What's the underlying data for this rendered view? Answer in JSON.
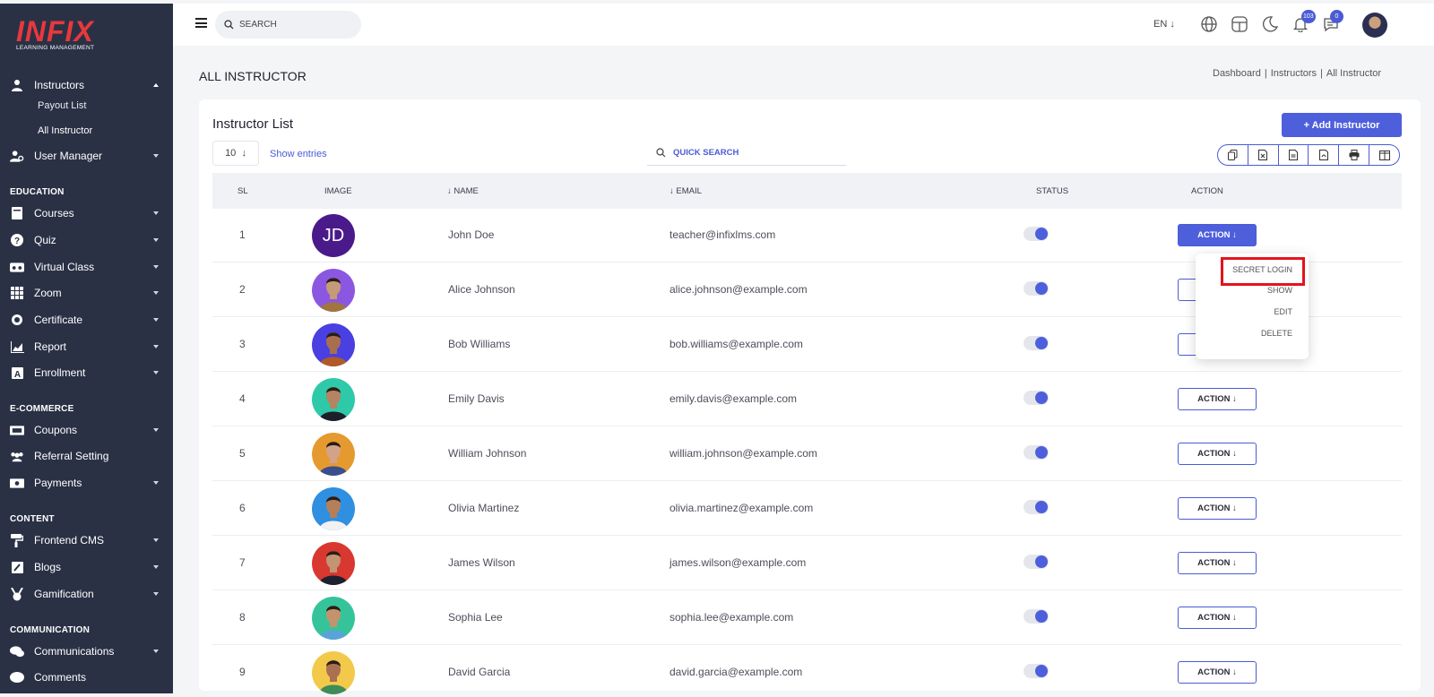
{
  "logo": {
    "name": "INFIX",
    "tagline": "LEARNING MANAGEMENT"
  },
  "sidebar": {
    "items": [
      {
        "label": "Instructors",
        "icon": "user-icon",
        "expanded": true
      },
      {
        "label": "User Manager",
        "icon": "users-cog-icon"
      },
      {
        "label": "Courses",
        "icon": "book-icon"
      },
      {
        "label": "Quiz",
        "icon": "question-circle-icon"
      },
      {
        "label": "Virtual Class",
        "icon": "vr-icon"
      },
      {
        "label": "Zoom",
        "icon": "grid-icon"
      },
      {
        "label": "Certificate",
        "icon": "certificate-icon"
      },
      {
        "label": "Report",
        "icon": "chart-icon"
      },
      {
        "label": "Enrollment",
        "icon": "enrollment-icon"
      },
      {
        "label": "Coupons",
        "icon": "coupon-icon"
      },
      {
        "label": "Referral Setting",
        "icon": "referral-icon"
      },
      {
        "label": "Payments",
        "icon": "money-icon"
      },
      {
        "label": "Frontend CMS",
        "icon": "paint-roller-icon"
      },
      {
        "label": "Blogs",
        "icon": "edit-icon"
      },
      {
        "label": "Gamification",
        "icon": "medal-icon"
      },
      {
        "label": "Communications",
        "icon": "chat-icon"
      },
      {
        "label": "Comments",
        "icon": "comment-icon"
      }
    ],
    "sub_items": [
      "Payout List",
      "All Instructor"
    ],
    "sections": [
      "EDUCATION",
      "E-COMMERCE",
      "CONTENT",
      "COMMUNICATION"
    ]
  },
  "header": {
    "search_placeholder": "SEARCH",
    "language": "EN",
    "notifications_count": "103",
    "messages_count": "0"
  },
  "page": {
    "title": "ALL INSTRUCTOR",
    "breadcrumb": [
      "Dashboard",
      "Instructors",
      "All Instructor"
    ]
  },
  "card": {
    "title": "Instructor List",
    "add_button": "+ Add Instructor",
    "entries_value": "10",
    "entries_label": "Show entries",
    "quick_search_placeholder": "QUICK SEARCH"
  },
  "table": {
    "headers": [
      "SL",
      "IMAGE",
      "NAME",
      "EMAIL",
      "STATUS",
      "ACTION"
    ],
    "rows": [
      {
        "sl": "1",
        "initials": "JD",
        "name": "John Doe",
        "email": "teacher@infixlms.com",
        "action": "ACTION"
      },
      {
        "sl": "2",
        "name": "Alice Johnson",
        "email": "alice.johnson@example.com",
        "action": "ACTION",
        "bg": "#8c57e0",
        "skin": "#c49a78",
        "shirt": "#a0753e"
      },
      {
        "sl": "3",
        "name": "Bob Williams",
        "email": "bob.williams@example.com",
        "action": "ACTION",
        "bg": "#4a3fe0",
        "skin": "#a86f4f",
        "shirt": "#b05a2a"
      },
      {
        "sl": "4",
        "name": "Emily Davis",
        "email": "emily.davis@example.com",
        "action": "ACTION",
        "bg": "#2ec9a8",
        "skin": "#b58463",
        "shirt": "#1d1f2b"
      },
      {
        "sl": "5",
        "name": "William Johnson",
        "email": "william.johnson@example.com",
        "action": "ACTION",
        "bg": "#e59a2f",
        "skin": "#d2a386",
        "shirt": "#3a4d8c"
      },
      {
        "sl": "6",
        "name": "Olivia Martinez",
        "email": "olivia.martinez@example.com",
        "action": "ACTION",
        "bg": "#2f8fe0",
        "skin": "#b57f5a",
        "shirt": "#f1f1f1"
      },
      {
        "sl": "7",
        "name": "James Wilson",
        "email": "james.wilson@example.com",
        "action": "ACTION",
        "bg": "#d8382f",
        "skin": "#c29474",
        "shirt": "#1e2030"
      },
      {
        "sl": "8",
        "name": "Sophia Lee",
        "email": "sophia.lee@example.com",
        "action": "ACTION",
        "bg": "#35c49a",
        "skin": "#c3936d",
        "shirt": "#5aa3d8"
      },
      {
        "sl": "9",
        "name": "David Garcia",
        "email": "david.garcia@example.com",
        "action": "ACTION",
        "bg": "#f2c94a",
        "skin": "#a97052",
        "shirt": "#3e8c5a"
      }
    ]
  },
  "dropdown": [
    "SECRET LOGIN",
    "SHOW",
    "EDIT",
    "DELETE"
  ],
  "colors": {
    "sidebar": "#2a3145",
    "accent": "#4e5fdc",
    "highlight": "#e4141b"
  }
}
